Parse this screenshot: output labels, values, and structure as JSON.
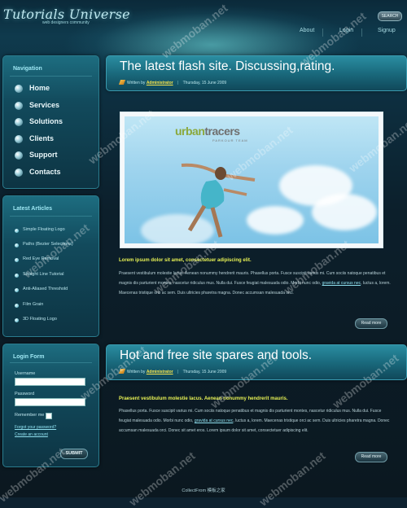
{
  "header": {
    "logo": "Tutorials Universe",
    "tagline": "web designers community",
    "search_button": "SEARCH",
    "nav": [
      "About",
      "Login",
      "Signup"
    ]
  },
  "sidebar": {
    "navigation": {
      "title": "Navigation",
      "items": [
        "Home",
        "Services",
        "Solutions",
        "Clients",
        "Support",
        "Contacts"
      ]
    },
    "latest_articles": {
      "title": "Latest Articles",
      "items": [
        "Simple Floating Logo",
        "Paths (Bezier Selections)",
        "Red Eye Removal",
        "Straight Line Tutorial",
        "Anti-Aliased Threshold",
        "Film Grain",
        "3D Floating Logo"
      ]
    },
    "login_form": {
      "title": "Login Form",
      "username_label": "Username",
      "password_label": "Password",
      "remember_label": "Remember me",
      "forgot_link": "Forgot your password?",
      "create_link": "Create an account",
      "submit": "SUBMIT"
    }
  },
  "posts": [
    {
      "title": "The latest flash site. Discussing,rating.",
      "written_by": "Written by",
      "author": "Administrator",
      "date": "Thursday, 15 June 2009",
      "image": {
        "logo_a": "urban",
        "logo_b": "tracers",
        "logo_sub": "PARKOUR TEAM"
      },
      "subtitle": "Lorem ipsum dolor sit amet, consectetuer adipiscing elit.",
      "body_before_link": "Praesent vestibulum molestie lacus. Aenean nonummy hendrerit mauris. Phasellus porta. Fusce suscipit varius mi. Cum sociis natoque penatibus et magnis dis parturient montes, nascetur ridiculus mus. Nulla dui. Fusce feugiat malesuada odio. Morbi nunc odio,",
      "link": "gravida at cursus nec",
      "body_after_link": ", luctus a, lorem. Maecenas tristique orci ac sem. Duis ultricies pharetra magna. Donec accumsan malesuada orci.",
      "read_more": "Read more"
    },
    {
      "title": "Hot and free site spares and tools.",
      "written_by": "Written by",
      "author": "Administrator",
      "date": "Thursday, 15 June 2009",
      "subtitle": "Praesent vestibulum molestie lacus. Aenean nonummy hendrerit mauris.",
      "body_before_link": "Phasellus porta. Fusce suscipit varius mi. Cum sociis natoque penatibus et magnis dis parturient montes, nascetur ridiculus mus. Nulla dui. Fusce feugiat malesuada odio. Morbi nunc odio,",
      "link": "gravida at cursus nec",
      "body_after_link": ", luctus a, lorem. Maecenas tristique orci ac sem. Duis ultricies pharetra magna. Donec accumsan malesuada orci. Donec sit amet eros. Lorem ipsum dolor sit amet, consectetuer adipiscing elit.",
      "read_more": "Read more"
    }
  ],
  "footer": "CollectFrom 模板之家",
  "watermark": "webmoban.net"
}
